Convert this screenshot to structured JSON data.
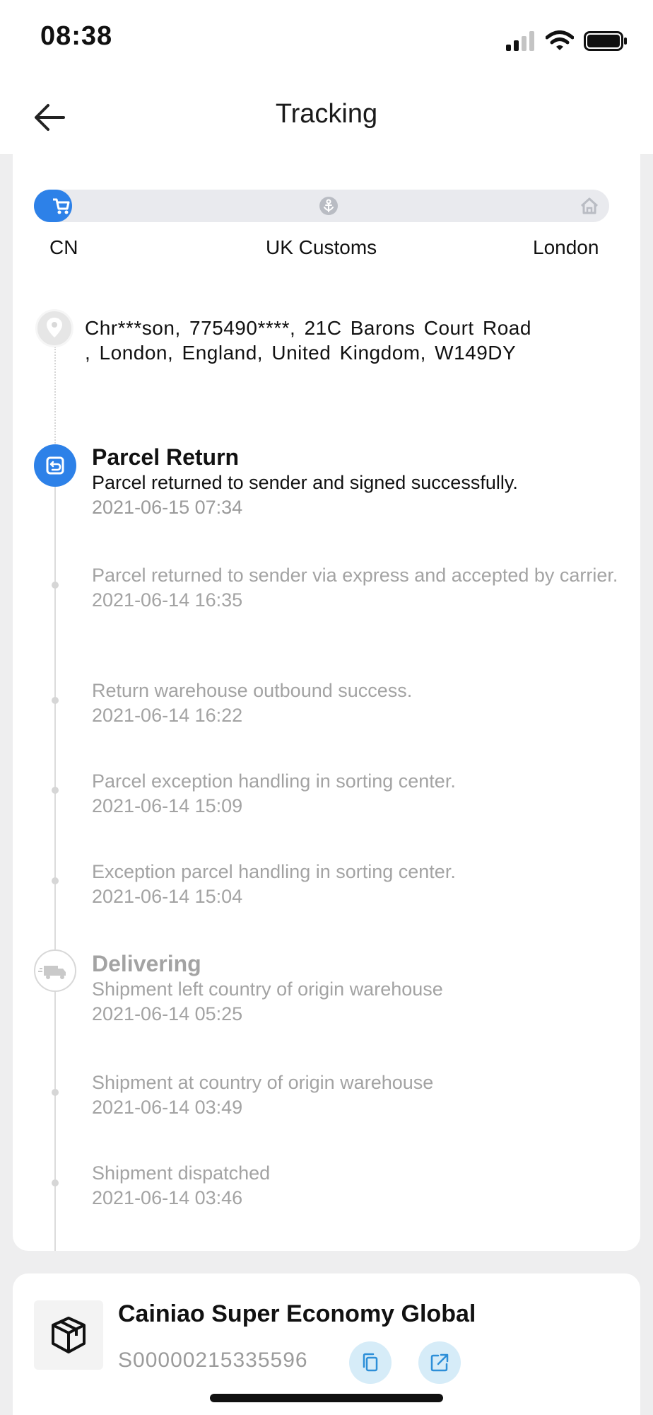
{
  "status_bar": {
    "time": "08:38"
  },
  "header": {
    "title": "Tracking"
  },
  "progress": {
    "stops": [
      "CN",
      "UK Customs",
      "London"
    ],
    "fraction": 0.06,
    "accent": "#2d81e8"
  },
  "address": {
    "text": "Chr***son,  775490****,  21C Barons Court Road ,  London,  England,  United Kingdom,  W149DY"
  },
  "events": [
    {
      "title": "Parcel Return",
      "description": "Parcel returned to sender and signed successfully.",
      "time": "2021-06-15 07:34"
    },
    {
      "description": "Parcel returned to sender via express and accepted by carrier.",
      "time": "2021-06-14 16:35"
    },
    {
      "description": "Return warehouse outbound success.",
      "time": "2021-06-14 16:22"
    },
    {
      "description": "Parcel exception handling in sorting center.",
      "time": "2021-06-14 15:09"
    },
    {
      "description": "Exception parcel handling in sorting center.",
      "time": "2021-06-14 15:04"
    },
    {
      "title": "Delivering",
      "description": "Shipment left country of origin warehouse",
      "time": "2021-06-14 05:25"
    },
    {
      "description": "Shipment at country of origin warehouse",
      "time": "2021-06-14 03:49"
    },
    {
      "description": "Shipment dispatched",
      "time": "2021-06-14 03:46"
    }
  ],
  "carrier": {
    "name": "Cainiao Super Economy Global",
    "tracking_number": "S00000215335596"
  },
  "icons": {
    "back": "arrow-left-icon",
    "origin": "cart-icon",
    "customs": "anchor-icon",
    "destination": "house-icon",
    "address": "location-pin-icon",
    "return": "return-icon",
    "delivering": "truck-icon",
    "package": "package-icon",
    "copy": "copy-icon",
    "external": "external-link-icon"
  }
}
